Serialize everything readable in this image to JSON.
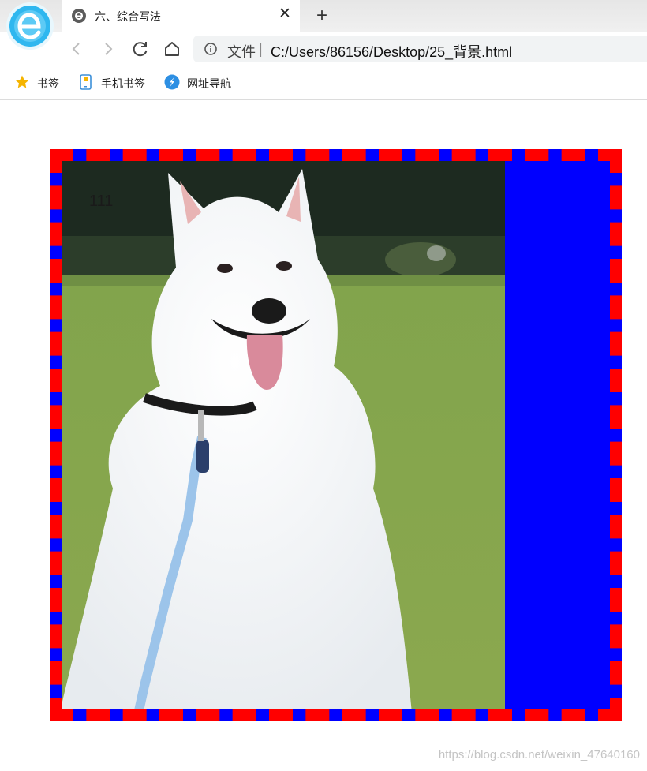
{
  "browser": {
    "tab": {
      "title": "六、综合写法"
    },
    "address": {
      "label": "文件",
      "separator": "|",
      "url": "C:/Users/86156/Desktop/25_背景.html"
    },
    "bookmarks": [
      {
        "label": "书签",
        "icon": "star-icon"
      },
      {
        "label": "手机书签",
        "icon": "phone-icon"
      },
      {
        "label": "网址导航",
        "icon": "navigation-icon"
      }
    ]
  },
  "page": {
    "box_text": "111",
    "colors": {
      "box_border": "#ff0000",
      "box_background": "#0000ff"
    }
  },
  "watermark": "https://blog.csdn.net/weixin_47640160"
}
